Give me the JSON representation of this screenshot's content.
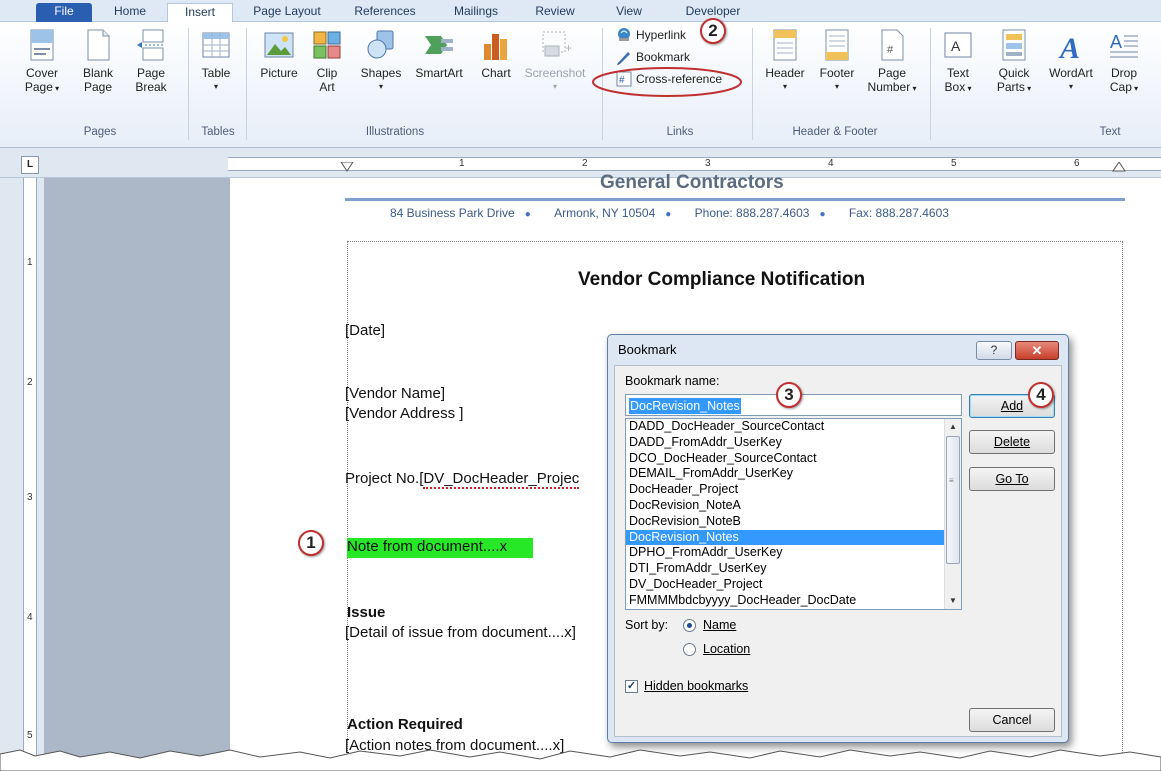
{
  "ribbon_tabs": [
    "File",
    "Home",
    "Insert",
    "Page Layout",
    "References",
    "Mailings",
    "Review",
    "View",
    "Developer"
  ],
  "active_tab": "Insert",
  "groups": {
    "pages": {
      "label": "Pages",
      "cover_l1": "Cover",
      "cover_l2": "Page",
      "blank_l1": "Blank",
      "blank_l2": "Page",
      "break_l1": "Page",
      "break_l2": "Break"
    },
    "tables": {
      "label": "Tables",
      "table": "Table"
    },
    "illustrations": {
      "label": "Illustrations",
      "picture": "Picture",
      "clip_l1": "Clip",
      "clip_l2": "Art",
      "shapes": "Shapes",
      "smartart": "SmartArt",
      "chart": "Chart",
      "screenshot": "Screenshot"
    },
    "links": {
      "label": "Links",
      "hyperlink": "Hyperlink",
      "bookmark": "Bookmark",
      "cross_reference": "Cross-reference"
    },
    "header_footer": {
      "label": "Header & Footer",
      "header": "Header",
      "footer": "Footer",
      "page_l1": "Page",
      "page_l2": "Number"
    },
    "text": {
      "label": "Text",
      "textbox_l1": "Text",
      "textbox_l2": "Box",
      "quick_l1": "Quick",
      "quick_l2": "Parts",
      "wordart": "WordArt",
      "drop_l1": "Drop",
      "drop_l2": "Cap"
    }
  },
  "ruler": {
    "tab_selector": "L",
    "numbers": [
      "1",
      "2",
      "3",
      "4",
      "5",
      "6"
    ],
    "left_numbers": [
      "1",
      "2",
      "3",
      "4",
      "5"
    ]
  },
  "callouts": [
    "1",
    "2",
    "3",
    "4"
  ],
  "document": {
    "company": "General Contractors",
    "address": "84 Business Park Drive",
    "city": "Armonk, NY 10504",
    "phone": "Phone: 888.287.4603",
    "fax": "Fax: 888.287.4603",
    "title": "Vendor Compliance Notification",
    "date": "Date",
    "vendor_name": "Vendor Name",
    "vendor_address": "Vendor Address",
    "project_label": "Project No.",
    "project_value": "DV_DocHeader_Projec",
    "note": "Note from document....",
    "note_mark": "x",
    "issue_heading": "Issue",
    "issue_text": "Detail of issue from document....",
    "issue_mark": "x",
    "action_heading": "Action Required",
    "action_text": "Action notes from document....",
    "action_mark": "x"
  },
  "dialog": {
    "title": "Bookmark",
    "help": "?",
    "close": "✕",
    "name_label": "Bookmark name:",
    "name_value": "DocRevision_Notes",
    "bookmarks": [
      "DADD_DocHeader_SourceContact",
      "DADD_FromAddr_UserKey",
      "DCO_DocHeader_SourceContact",
      "DEMAIL_FromAddr_UserKey",
      "DocHeader_Project",
      "DocRevision_NoteA",
      "DocRevision_NoteB",
      "DocRevision_Notes",
      "DPHO_FromAddr_UserKey",
      "DTI_FromAddr_UserKey",
      "DV_DocHeader_Project",
      "FMMMMbdcbyyyy_DocHeader_DocDate"
    ],
    "selected_bookmark": "DocRevision_Notes",
    "add": "Add",
    "delete": "Delete",
    "goto": "Go To",
    "sort_by": "Sort by:",
    "sort_name": "Name",
    "sort_location": "Location",
    "sort_selected": "Name",
    "hidden_label": "Hidden bookmarks",
    "hidden_checked": true,
    "cancel": "Cancel"
  }
}
